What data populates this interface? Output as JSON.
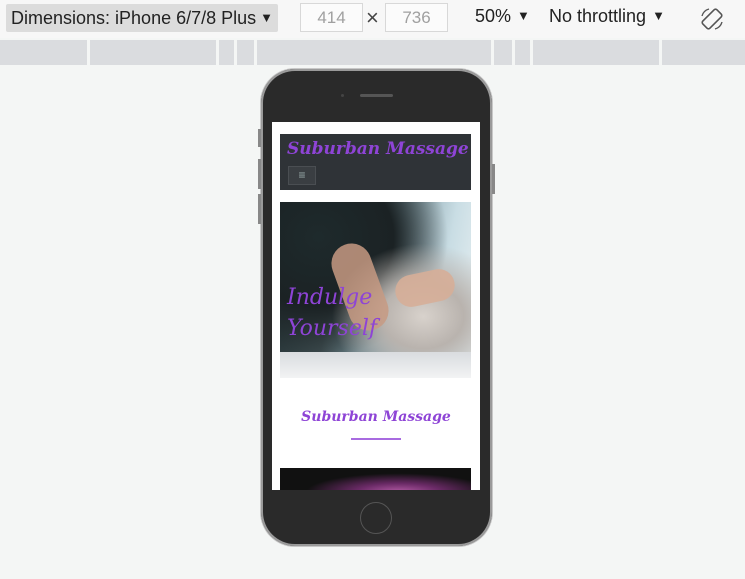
{
  "toolbar": {
    "dimensions_label": "Dimensions: iPhone 6/7/8 Plus",
    "width": "414",
    "height": "736",
    "times": "×",
    "zoom": "50%",
    "throttling": "No throttling",
    "rotate_icon": "rotate-device-icon"
  },
  "site": {
    "title": "Suburban Massage",
    "menu_icon": "≡",
    "hero_text_line1": "Indulge",
    "hero_text_line2": "Yourself",
    "section_title": "Suburban Massage",
    "accent_color": "#8e44d6"
  }
}
